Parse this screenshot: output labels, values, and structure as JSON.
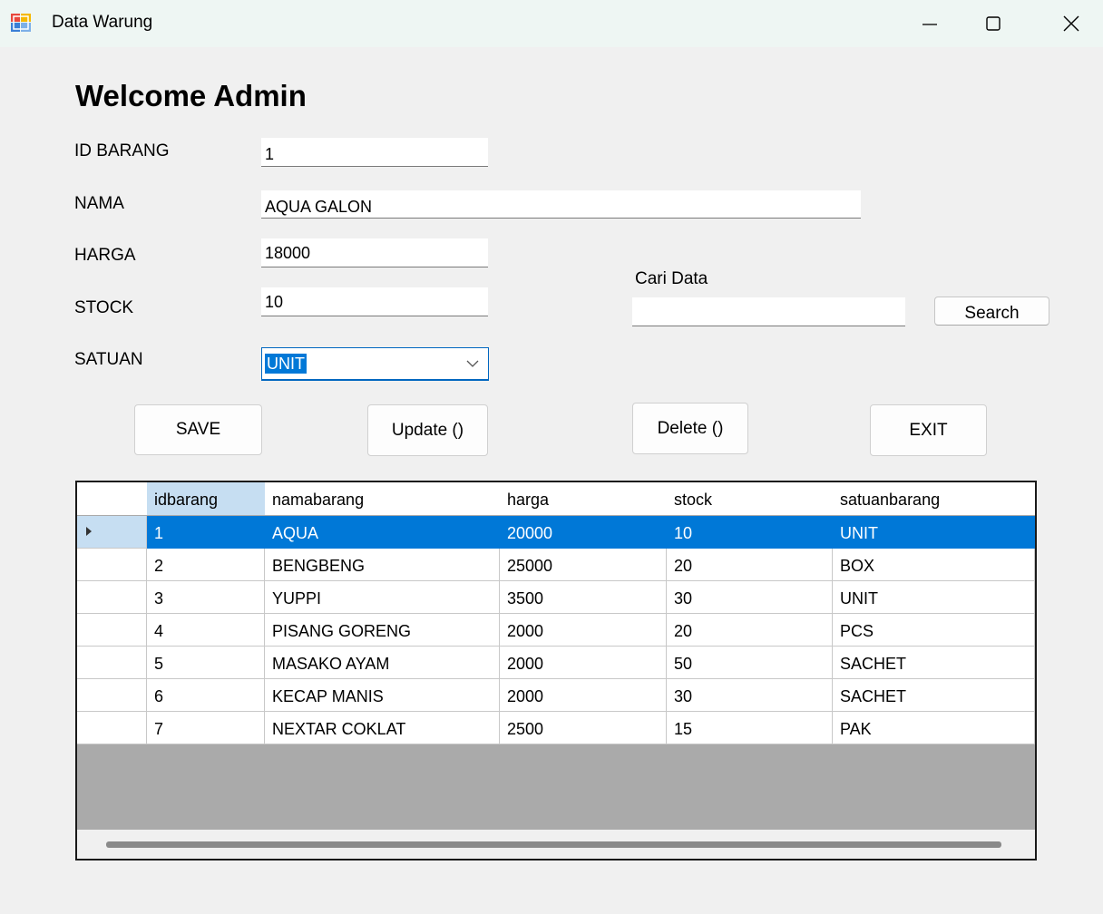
{
  "window": {
    "title": "Data Warung",
    "controls": [
      "minimize-icon",
      "maximize-icon",
      "close-icon"
    ]
  },
  "heading": "Welcome Admin",
  "form": {
    "id_label": "ID BARANG",
    "id_value": "1",
    "nama_label": "NAMA",
    "nama_value": "AQUA GALON",
    "harga_label": "HARGA",
    "harga_value": "18000",
    "stock_label": "STOCK",
    "stock_value": "10",
    "satuan_label": "SATUAN",
    "satuan_value": "UNIT"
  },
  "search": {
    "label": "Cari Data",
    "value": "",
    "button": "Search"
  },
  "buttons": {
    "save": "SAVE",
    "update": "Update ()",
    "delete": "Delete ()",
    "exit": "EXIT"
  },
  "table": {
    "columns": [
      "idbarang",
      "namabarang",
      "harga",
      "stock",
      "satuanbarang"
    ],
    "rows": [
      [
        "1",
        "AQUA",
        "20000",
        "10",
        "UNIT"
      ],
      [
        "2",
        "BENGBENG",
        "25000",
        "20",
        "BOX"
      ],
      [
        "3",
        "YUPPI",
        "3500",
        "30",
        "UNIT"
      ],
      [
        "4",
        "PISANG GORENG",
        "2000",
        "20",
        "PCS"
      ],
      [
        "5",
        "MASAKO AYAM",
        "2000",
        "50",
        "SACHET"
      ],
      [
        "6",
        "KECAP MANIS",
        "2000",
        "30",
        "SACHET"
      ],
      [
        "7",
        "NEXTAR COKLAT",
        "2500",
        "15",
        "PAK"
      ]
    ],
    "selected_row": 0
  },
  "colors": {
    "selection": "#0078d7",
    "header_active": "#c6def2",
    "titlebar": "#eef6f3"
  }
}
